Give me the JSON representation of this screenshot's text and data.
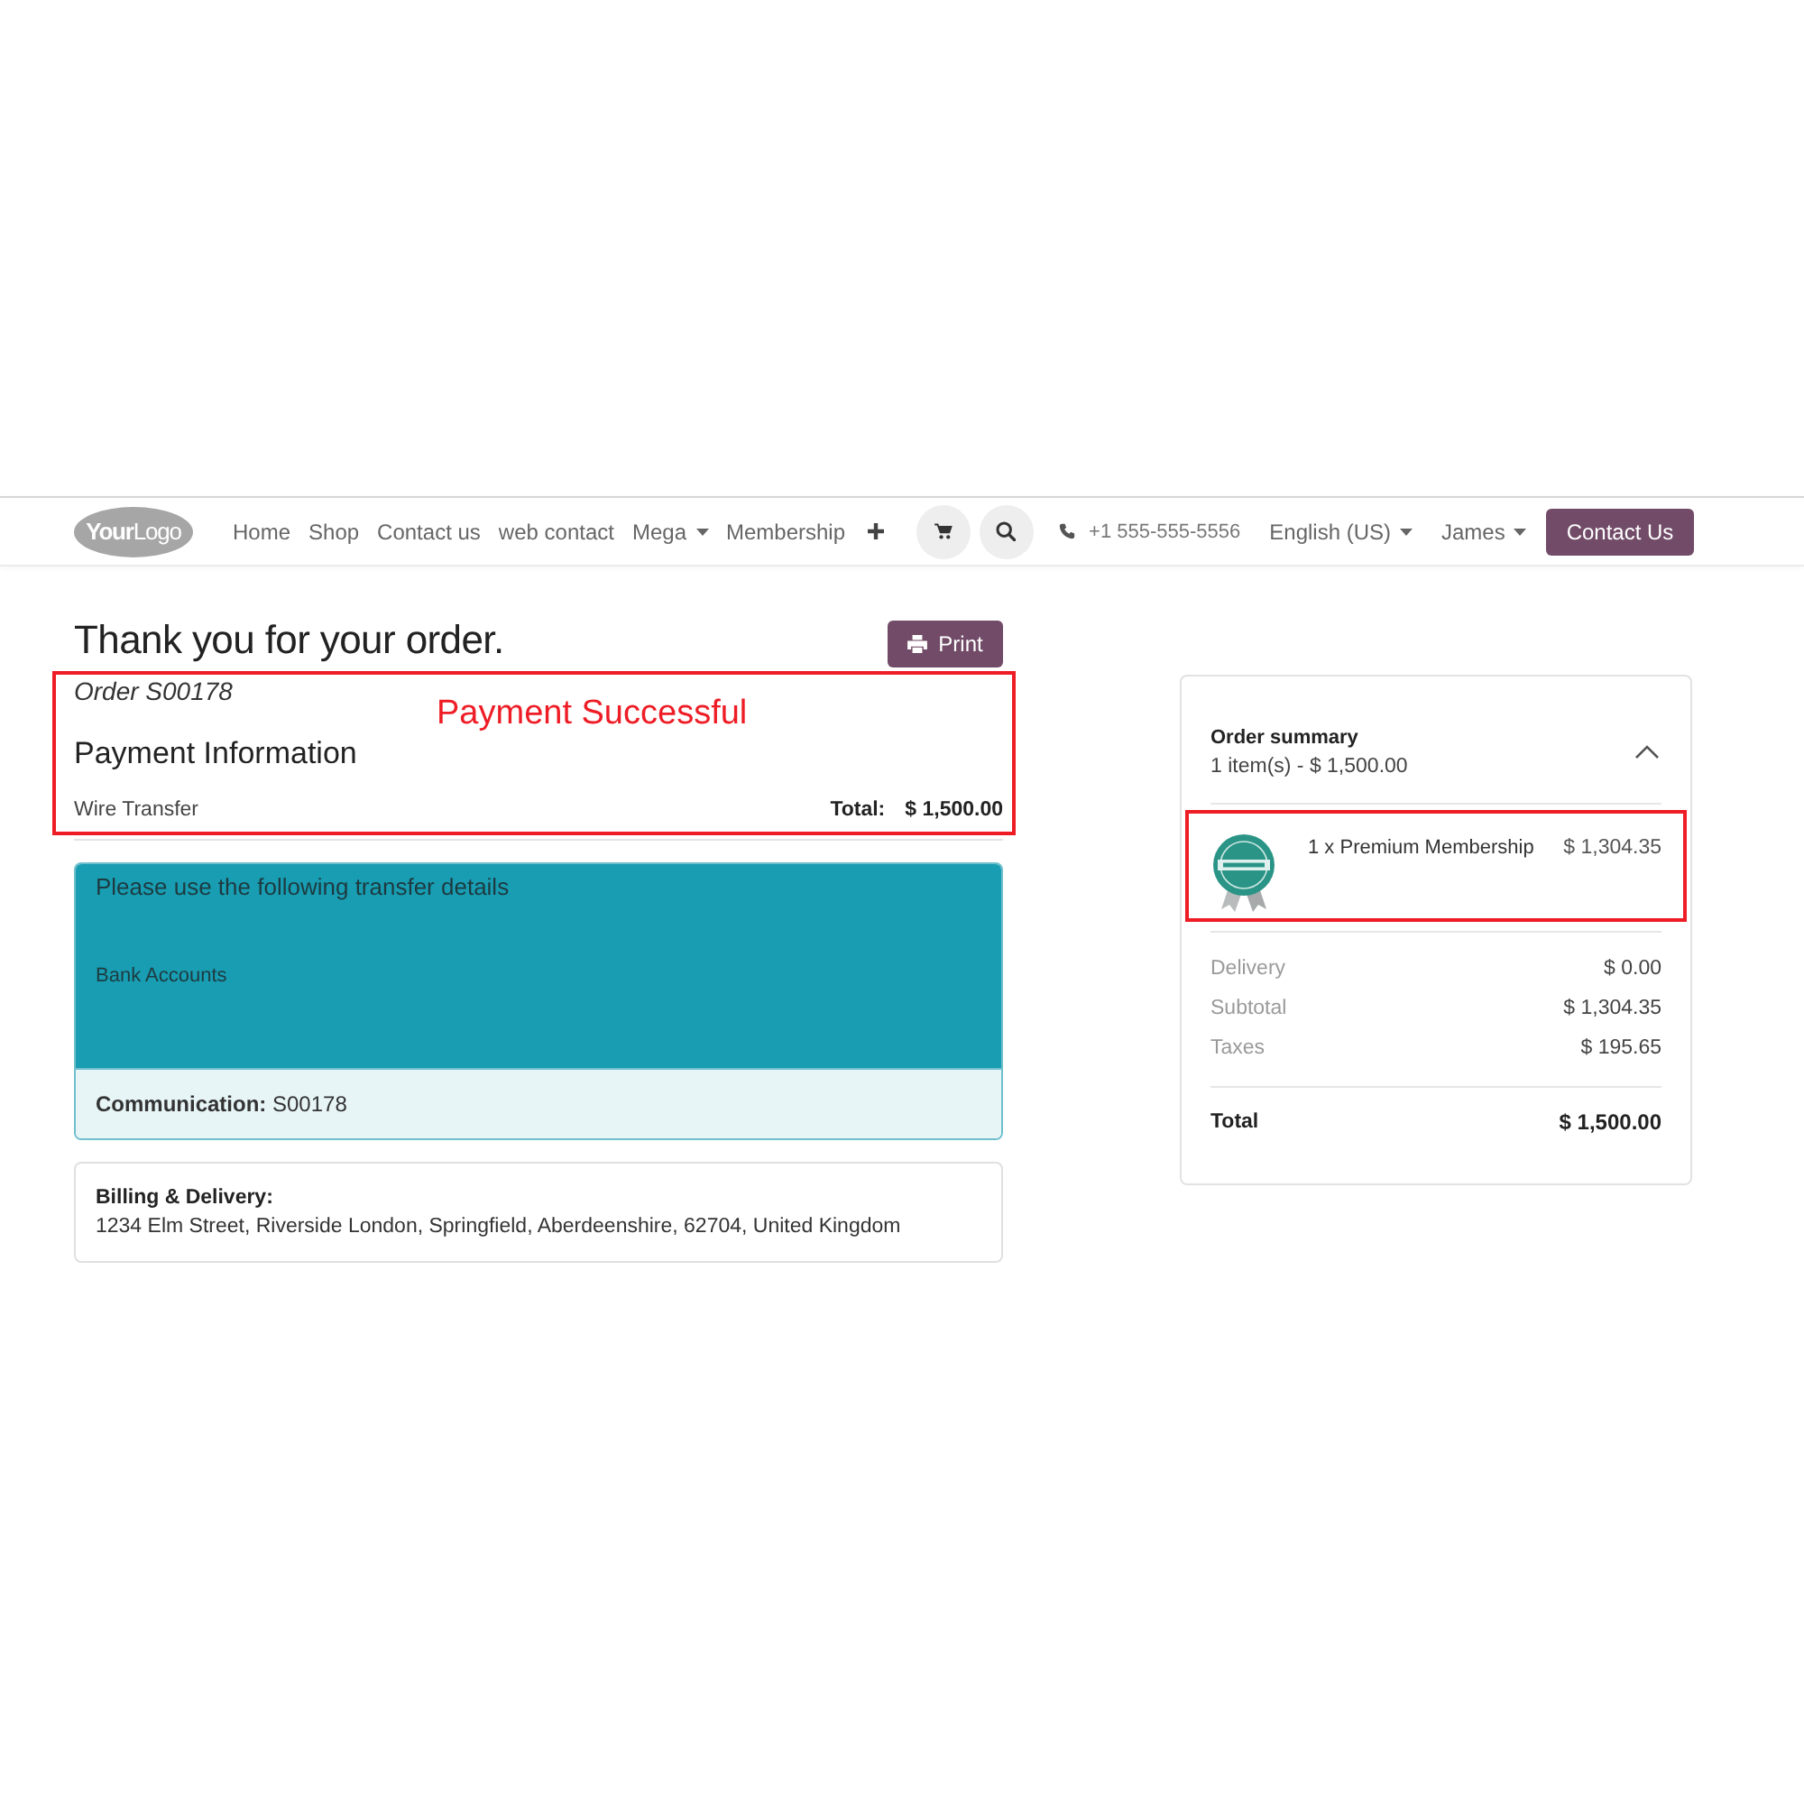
{
  "navbar": {
    "logo": "**Your**Logo",
    "menu": [
      {
        "label": "Home",
        "kind": "link"
      },
      {
        "label": "Shop",
        "kind": "link"
      },
      {
        "label": "Contact us",
        "kind": "link"
      },
      {
        "label": "web contact",
        "kind": "link"
      },
      {
        "label": "Mega",
        "kind": "dropdown"
      },
      {
        "label": "Membership",
        "kind": "link"
      }
    ],
    "phone": "+1 555-555-5556",
    "language": "English (US)",
    "user": "James",
    "contact_button": "Contact Us"
  },
  "confirmation": {
    "title": "Thank you for your order.",
    "print_button": "Print",
    "highlighted": true,
    "annotation": "Payment Successful",
    "order": "Order S00178",
    "payment_heading": "Payment Information",
    "method": "Wire Transfer",
    "total_label": "Total:",
    "total": "$ 1,500.00"
  },
  "transfer": {
    "heading": "Please use the following transfer details",
    "bank_accounts": "Bank Accounts",
    "communication": "**Communication:** S00178"
  },
  "billing": {
    "label": "Billing & Delivery:",
    "address": "1234 Elm Street, Riverside London, Springfield, Aberdeenshire, 62704, United Kingdom"
  },
  "summary": {
    "title": "Order summary",
    "subtitle": "1 item(s) - $ 1,500.00",
    "expanded": true,
    "lines": [
      {
        "description": "1 x Premium Membership",
        "price": "$ 1,304.35",
        "highlighted": true
      }
    ],
    "amounts": [
      {
        "label": "Delivery",
        "value": "$ 0.00"
      },
      {
        "label": "Subtotal",
        "value": "$ 1,304.35"
      },
      {
        "label": "Taxes",
        "value": "$ 195.65"
      }
    ],
    "total_label": "Total",
    "total": "$ 1,500.00"
  }
}
